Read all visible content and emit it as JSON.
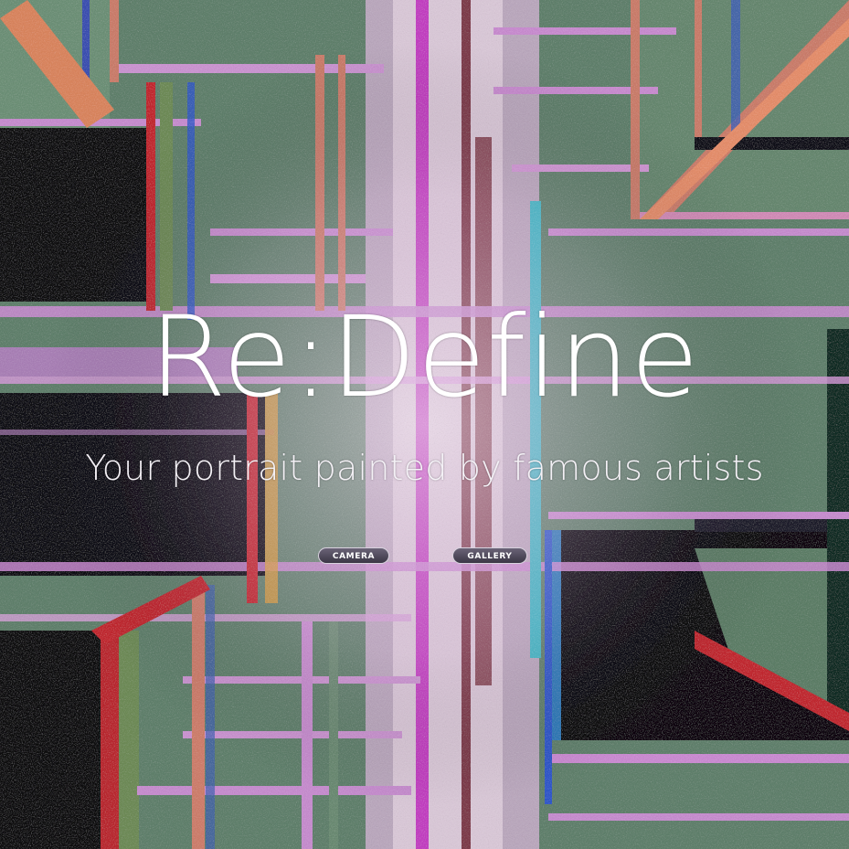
{
  "hero": {
    "title": "Re:Define",
    "tagline": "Your portrait painted by famous artists"
  },
  "buttons": {
    "camera_label": "CAMERA",
    "gallery_label": "GALLERY"
  },
  "colors": {
    "text": "#ffffff",
    "button_fill": "#4a4454",
    "background_dark": "#0c0a12",
    "background_green": "#5d7f69",
    "glitch_pink": "#c98ad0",
    "glitch_red": "#c0262f",
    "glitch_blue": "#2e57c8"
  },
  "background": {
    "image": "glitch-circuit-artwork"
  }
}
